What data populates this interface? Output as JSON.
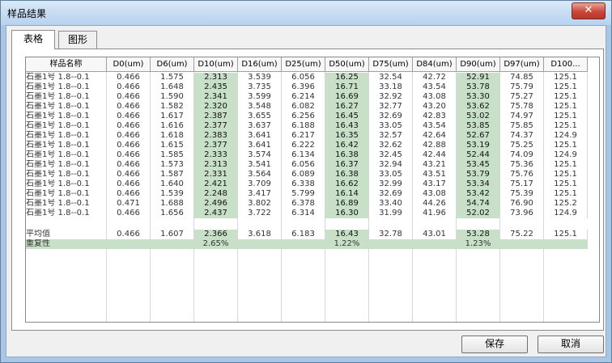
{
  "window": {
    "title": "样品结果",
    "close_glyph": "✕"
  },
  "tabs": [
    {
      "label": "表格"
    },
    {
      "label": "图形"
    }
  ],
  "table": {
    "headers": [
      "样品名称",
      "D0(um)",
      "D6(um)",
      "D10(um)",
      "D16(um)",
      "D25(um)",
      "D50(um)",
      "D75(um)",
      "D84(um)",
      "D90(um)",
      "D97(um)",
      "D100..."
    ],
    "rows": [
      [
        "石墨1号  1.8--0.1",
        "0.466",
        "1.575",
        "2.313",
        "3.539",
        "6.056",
        "16.25",
        "32.54",
        "42.72",
        "52.91",
        "74.85",
        "125.1"
      ],
      [
        "石墨1号  1.8--0.1",
        "0.466",
        "1.648",
        "2.435",
        "3.735",
        "6.396",
        "16.71",
        "33.18",
        "43.54",
        "53.78",
        "75.79",
        "125.1"
      ],
      [
        "石墨1号  1.8--0.1",
        "0.466",
        "1.590",
        "2.341",
        "3.599",
        "6.214",
        "16.69",
        "32.92",
        "43.08",
        "53.30",
        "75.27",
        "125.1"
      ],
      [
        "石墨1号  1.8--0.1",
        "0.466",
        "1.582",
        "2.320",
        "3.548",
        "6.082",
        "16.27",
        "32.77",
        "43.20",
        "53.62",
        "75.78",
        "125.1"
      ],
      [
        "石墨1号  1.8--0.1",
        "0.466",
        "1.617",
        "2.387",
        "3.655",
        "6.256",
        "16.45",
        "32.69",
        "42.83",
        "53.02",
        "74.97",
        "125.1"
      ],
      [
        "石墨1号  1.8--0.1",
        "0.466",
        "1.616",
        "2.377",
        "3.637",
        "6.188",
        "16.43",
        "33.05",
        "43.54",
        "53.85",
        "75.85",
        "125.1"
      ],
      [
        "石墨1号  1.8--0.1",
        "0.466",
        "1.618",
        "2.383",
        "3.641",
        "6.217",
        "16.35",
        "32.57",
        "42.64",
        "52.67",
        "74.37",
        "124.9"
      ],
      [
        "石墨1号  1.8--0.1",
        "0.466",
        "1.615",
        "2.377",
        "3.641",
        "6.222",
        "16.42",
        "32.62",
        "42.88",
        "53.19",
        "75.25",
        "125.1"
      ],
      [
        "石墨1号  1.8--0.1",
        "0.466",
        "1.585",
        "2.333",
        "3.574",
        "6.134",
        "16.38",
        "32.45",
        "42.44",
        "52.44",
        "74.09",
        "124.9"
      ],
      [
        "石墨1号  1.8--0.1",
        "0.466",
        "1.573",
        "2.313",
        "3.541",
        "6.056",
        "16.37",
        "32.94",
        "43.21",
        "53.45",
        "75.36",
        "125.1"
      ],
      [
        "石墨1号  1.8--0.1",
        "0.466",
        "1.587",
        "2.331",
        "3.564",
        "6.089",
        "16.38",
        "33.05",
        "43.51",
        "53.79",
        "75.76",
        "125.1"
      ],
      [
        "石墨1号  1.8--0.1",
        "0.466",
        "1.640",
        "2.421",
        "3.709",
        "6.338",
        "16.62",
        "32.99",
        "43.17",
        "53.34",
        "75.17",
        "125.1"
      ],
      [
        "石墨1号  1.8--0.1",
        "0.466",
        "1.539",
        "2.248",
        "3.417",
        "5.799",
        "16.14",
        "32.69",
        "43.08",
        "53.42",
        "75.39",
        "125.1"
      ],
      [
        "石墨1号  1.8--0.1",
        "0.471",
        "1.688",
        "2.496",
        "3.802",
        "6.378",
        "16.89",
        "33.40",
        "44.26",
        "54.74",
        "76.90",
        "125.2"
      ],
      [
        "石墨1号  1.8--0.1",
        "0.466",
        "1.656",
        "2.437",
        "3.722",
        "6.314",
        "16.30",
        "31.99",
        "41.96",
        "52.02",
        "73.96",
        "124.9"
      ]
    ],
    "average": [
      "平均值",
      "0.466",
      "1.607",
      "2.366",
      "3.618",
      "6.183",
      "16.43",
      "32.78",
      "43.01",
      "53.28",
      "75.22",
      "125.1"
    ],
    "repeatability": [
      "重复性",
      "",
      "",
      "2.65%",
      "",
      "",
      "1.22%",
      "",
      "",
      "1.23%",
      "",
      ""
    ],
    "highlight_color": "#c8e0c8"
  },
  "buttons": {
    "save": "保存",
    "cancel": "取消"
  }
}
